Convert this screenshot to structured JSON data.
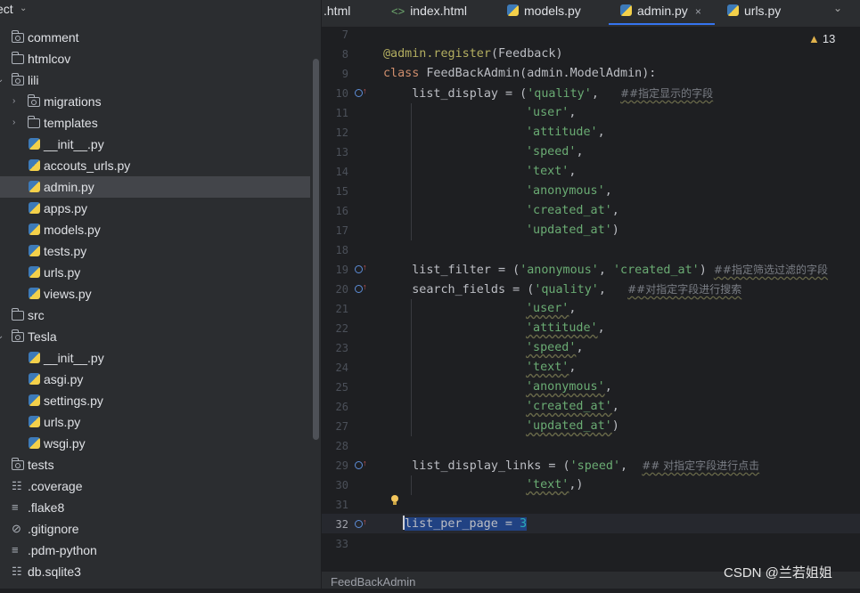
{
  "project": {
    "title": "ect",
    "chevron_icon": "chevron-down-icon"
  },
  "tree": [
    {
      "label": "comment",
      "type": "package",
      "expanded": false,
      "indent": 0
    },
    {
      "label": "htmlcov",
      "type": "folder",
      "expanded": false,
      "indent": 0
    },
    {
      "label": "lili",
      "type": "package",
      "expanded": true,
      "indent": 0
    },
    {
      "label": "migrations",
      "type": "package",
      "expanded": false,
      "indent": 1
    },
    {
      "label": "templates",
      "type": "folder",
      "expanded": false,
      "indent": 1
    },
    {
      "label": "__init__.py",
      "type": "python",
      "indent": 1
    },
    {
      "label": "accouts_urls.py",
      "type": "python",
      "indent": 1
    },
    {
      "label": "admin.py",
      "type": "python",
      "indent": 1,
      "selected": true
    },
    {
      "label": "apps.py",
      "type": "python",
      "indent": 1
    },
    {
      "label": "models.py",
      "type": "python",
      "indent": 1
    },
    {
      "label": "tests.py",
      "type": "python",
      "indent": 1
    },
    {
      "label": "urls.py",
      "type": "python",
      "indent": 1
    },
    {
      "label": "views.py",
      "type": "python",
      "indent": 1
    },
    {
      "label": "src",
      "type": "folder",
      "expanded": false,
      "indent": 0
    },
    {
      "label": "Tesla",
      "type": "package",
      "expanded": true,
      "indent": 0
    },
    {
      "label": "__init__.py",
      "type": "python",
      "indent": 1
    },
    {
      "label": "asgi.py",
      "type": "python",
      "indent": 1
    },
    {
      "label": "settings.py",
      "type": "python",
      "indent": 1
    },
    {
      "label": "urls.py",
      "type": "python",
      "indent": 1
    },
    {
      "label": "wsgi.py",
      "type": "python",
      "indent": 1
    },
    {
      "label": "tests",
      "type": "package",
      "expanded": false,
      "indent": 0
    },
    {
      "label": ".coverage",
      "type": "db",
      "indent": 0
    },
    {
      "label": ".flake8",
      "type": "text",
      "indent": 0
    },
    {
      "label": ".gitignore",
      "type": "ignore",
      "indent": 0
    },
    {
      "label": ".pdm-python",
      "type": "text",
      "indent": 0
    },
    {
      "label": "db.sqlite3",
      "type": "db",
      "indent": 0
    }
  ],
  "tabs": [
    {
      "label": ".html",
      "icon": "none"
    },
    {
      "label": "index.html",
      "icon": "html-icon"
    },
    {
      "label": "models.py",
      "icon": "python-icon"
    },
    {
      "label": "admin.py",
      "icon": "python-icon",
      "active": true,
      "close": "×"
    },
    {
      "label": "urls.py",
      "icon": "python-icon"
    }
  ],
  "tab_more_icon": "chevron-down-icon",
  "inspections": {
    "count": "13",
    "icon": "warning-icon"
  },
  "line_numbers": [
    "7",
    "8",
    "9",
    "10",
    "11",
    "12",
    "13",
    "14",
    "15",
    "16",
    "17",
    "18",
    "19",
    "20",
    "21",
    "22",
    "23",
    "24",
    "25",
    "26",
    "27",
    "28",
    "29",
    "30",
    "31",
    "32",
    "33"
  ],
  "current_line": "32",
  "code": {
    "l8_dec": "@admin.register",
    "l8_arg": "(Feedback)",
    "l9_kw": "class",
    "l9_rest": " FeedBackAdmin(admin.ModelAdmin):",
    "l10_pre": "    list_display = (",
    "l10_str": "'quality'",
    "l10_post": ",   ",
    "l10_cmt": "##指定显示的字段",
    "l11": "'user'",
    "l12": "'attitude'",
    "l13": "'speed'",
    "l14": "'text'",
    "l15": "'anonymous'",
    "l16": "'created_at'",
    "l17": "'updated_at'",
    "l19_pre": "    list_filter = (",
    "l19_s1": "'anonymous'",
    "l19_mid": ", ",
    "l19_s2": "'created_at'",
    "l19_post": ") ",
    "l19_cmt": "##指定筛选过滤的字段",
    "l20_pre": "    search_fields = (",
    "l20_str": "'quality'",
    "l20_post": ",   ",
    "l20_cmt": "##对指定字段进行搜索",
    "l21": "'user'",
    "l22": "'attitude'",
    "l23": "'speed'",
    "l24": "'text'",
    "l25": "'anonymous'",
    "l26": "'created_at'",
    "l27": "'updated_at'",
    "l29_pre": "    list_display_links = (",
    "l29_str": "'speed'",
    "l29_post": ",  ",
    "l29_cmt": "## 对指定字段进行点击",
    "l30_str": "'text'",
    "l30_post": ",)",
    "l32_text": "list_per_page = ",
    "l32_num": "3"
  },
  "status": {
    "breadcrumb": "FeedBackAdmin"
  },
  "watermark": "CSDN @兰若姐姐"
}
